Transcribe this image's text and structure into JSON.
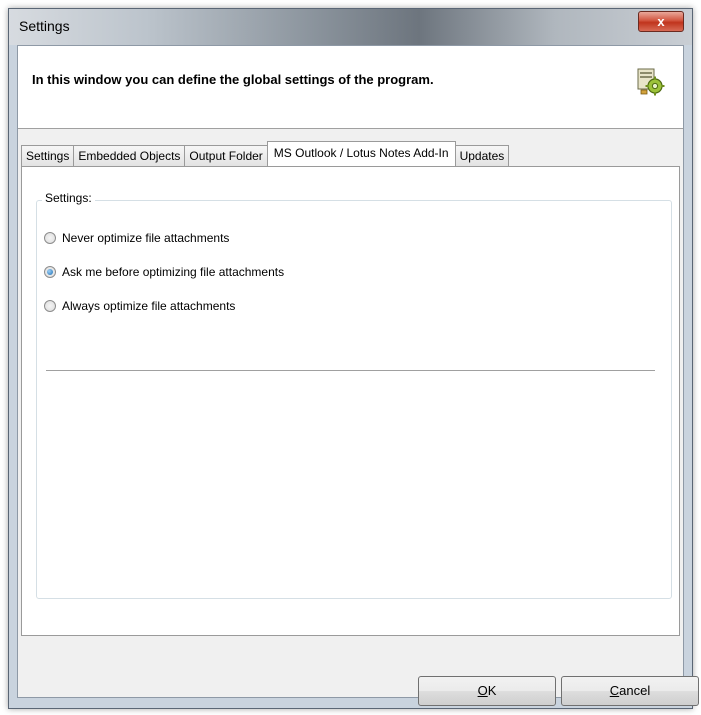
{
  "window": {
    "title": "Settings",
    "close_label": "x"
  },
  "header": {
    "text": "In this window you can define the global settings of the program.",
    "icon": "settings-gear-icon"
  },
  "tabs": [
    {
      "label": "Settings",
      "active": false
    },
    {
      "label": "Embedded Objects",
      "active": false
    },
    {
      "label": "Output Folder",
      "active": false
    },
    {
      "label": "MS Outlook / Lotus Notes Add-In",
      "active": true
    },
    {
      "label": "Updates",
      "active": false
    }
  ],
  "group": {
    "title": "Settings:",
    "options": [
      {
        "label": "Never optimize file attachments",
        "checked": false
      },
      {
        "label": "Ask me before optimizing file attachments",
        "checked": true
      },
      {
        "label": "Always optimize file attachments",
        "checked": false
      }
    ]
  },
  "buttons": {
    "ok_mnemonic": "O",
    "ok_rest": "K",
    "cancel_mnemonic": "C",
    "cancel_rest": "ancel"
  },
  "colors": {
    "close_button": "#c0341d",
    "radio_selected": "#1e6fb5"
  }
}
